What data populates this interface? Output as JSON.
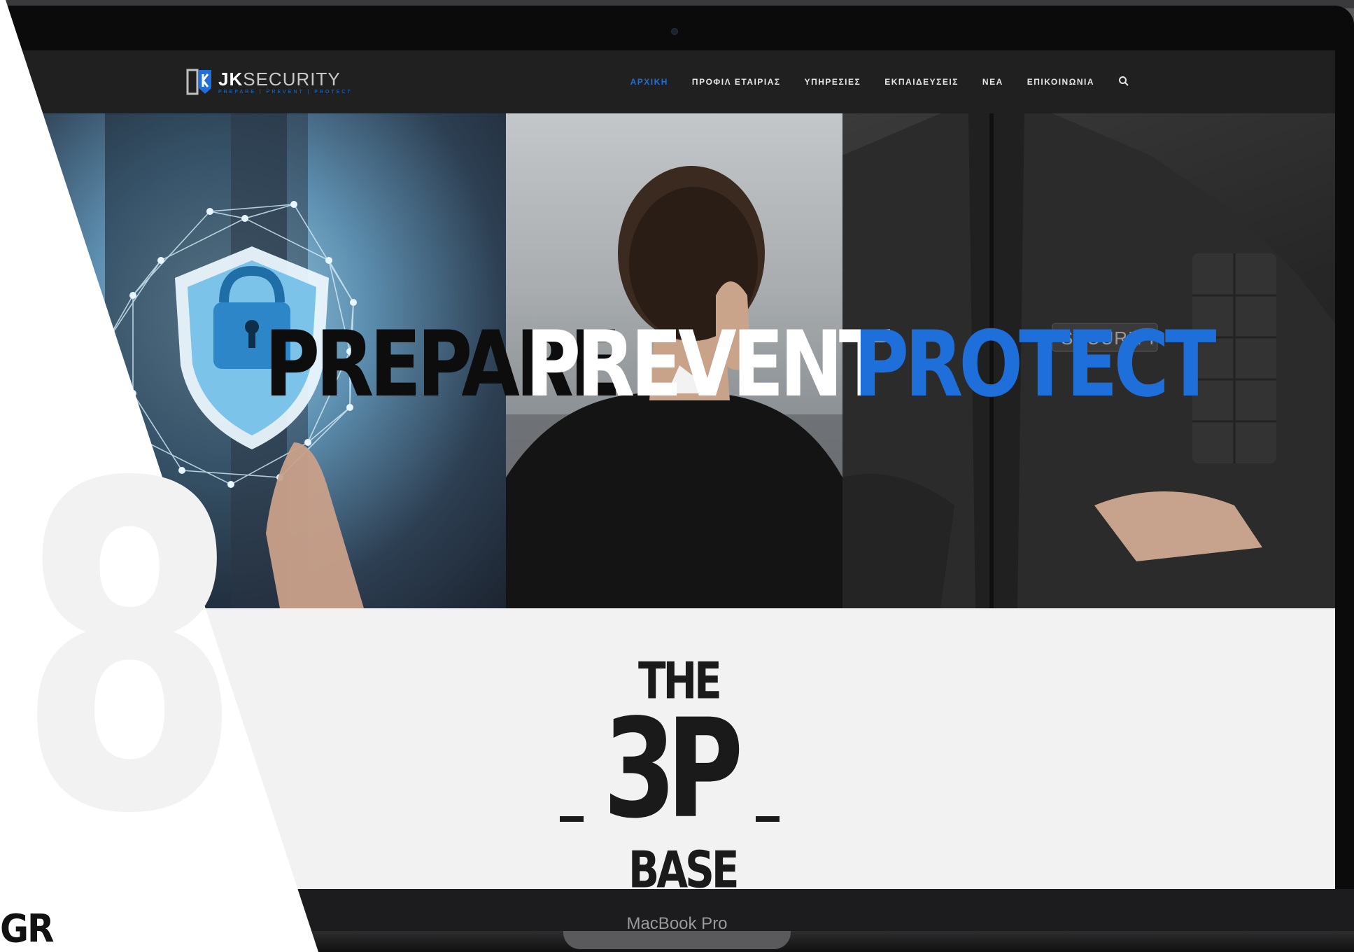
{
  "navbar": {
    "logo": {
      "brand_bold": "JK",
      "brand_light": "SECURITY",
      "tagline": "PREPARE | PREVENT | PROTECT"
    },
    "menu": [
      {
        "label": "ΑΡΧΙΚΗ",
        "active": true
      },
      {
        "label": "ΠΡΟΦΙΛ ΕΤΑΙΡΙΑΣ",
        "active": false
      },
      {
        "label": "ΥΠΗΡΕΣΙΕΣ",
        "active": false
      },
      {
        "label": "ΕΚΠΑΙΔΕΥΣΕΙΣ",
        "active": false
      },
      {
        "label": "ΝΕΑ",
        "active": false
      },
      {
        "label": "ΕΠΙΚΟΙΝΩΝΙΑ",
        "active": false
      }
    ],
    "search_icon": "search-icon"
  },
  "hero": {
    "words": [
      "PREPARE",
      "PREVENT",
      "PROTECT"
    ],
    "patch_text": "SECURITY"
  },
  "section": {
    "the": "THE",
    "three_p": "3P",
    "base": "BASE"
  },
  "device": {
    "label": "MacBook Pro"
  },
  "overlay": {
    "number": "8",
    "corner_text": "GR"
  },
  "colors": {
    "accent": "#1e6fd9",
    "navbar": "#202020",
    "page_bg": "#f2f2f2"
  }
}
